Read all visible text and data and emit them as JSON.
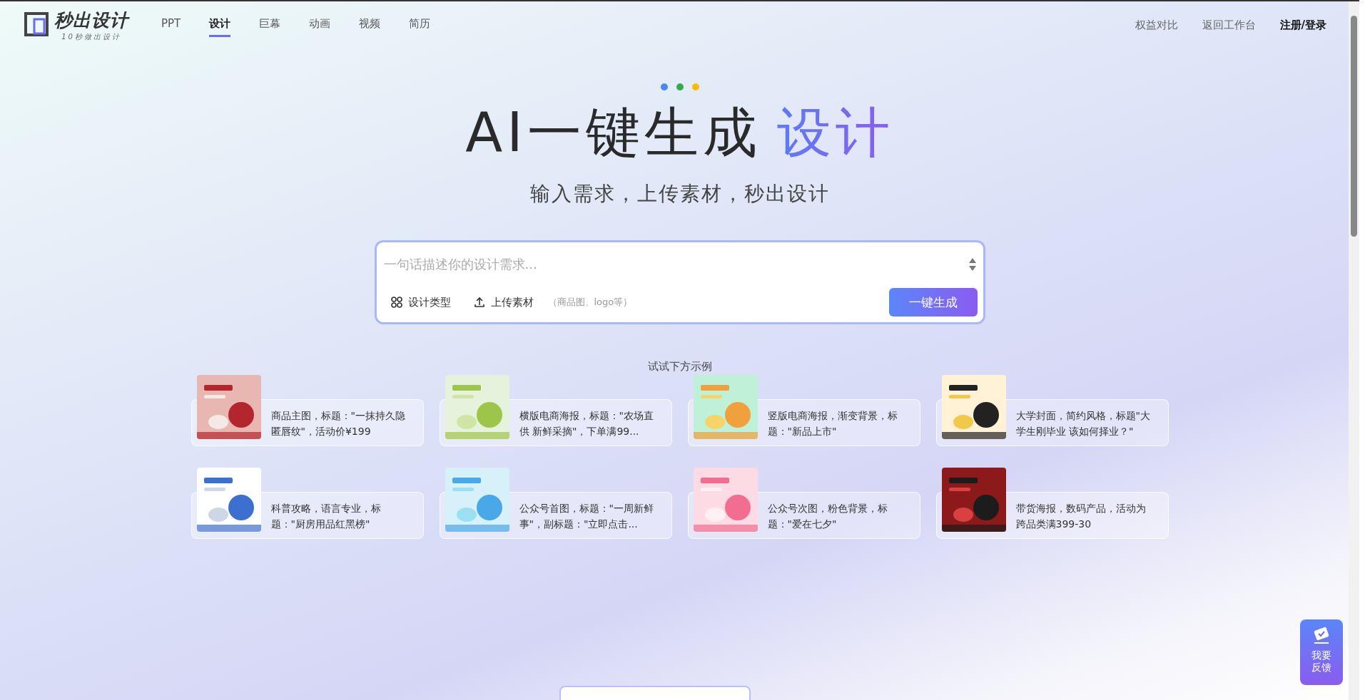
{
  "logo": {
    "name": "秒出设计",
    "tagline": "10秒做出设计"
  },
  "nav": [
    {
      "label": "PPT",
      "selected": false
    },
    {
      "label": "设计",
      "selected": true
    },
    {
      "label": "巨幕",
      "selected": false
    },
    {
      "label": "动画",
      "selected": false
    },
    {
      "label": "视频",
      "selected": false
    },
    {
      "label": "简历",
      "selected": false
    }
  ],
  "top_links": [
    {
      "label": "权益对比",
      "kind": "link"
    },
    {
      "label": "返回工作台",
      "kind": "link"
    },
    {
      "label": "注册/登录",
      "kind": "strong"
    }
  ],
  "hero": {
    "title": "AI一键生成",
    "title_accent": "设计",
    "subtitle": "输入需求，上传素材，秒出设计"
  },
  "prompt": {
    "placeholder": "一句话描述你的设计需求...",
    "type_button": "设计类型",
    "upload_button": "上传素材",
    "upload_hint": "（商品图、logo等）",
    "generate_button": "一键生成"
  },
  "examples_title": "试试下方示例",
  "examples": [
    {
      "text": "商品主图，标题：\"一抹持久隐匿唇纹\"，活动价¥199",
      "kind": "picture"
    },
    {
      "text": "横版电商海报，标题：\"农场直供 新鲜采摘\"，下单满99...",
      "kind": "picture"
    },
    {
      "text": "竖版电商海报，渐变背景，标题：\"新品上市\"",
      "kind": "picture"
    },
    {
      "text": "大学封面，简约风格，标题\"大学生刚毕业 该如何择业？\"",
      "kind": "picture"
    },
    {
      "text": "科普攻略，语言专业，标题：\"厨房用品红黑榜\"",
      "kind": "picture"
    },
    {
      "text": "公众号首图，标题：\"一周新鲜事\"，副标题：\"立即点击...",
      "kind": "picture"
    },
    {
      "text": "公众号次图，粉色背景，标题：\"爱在七夕\"",
      "kind": "picture"
    },
    {
      "text": "带货海报，数码产品，活动为跨品类满399-30",
      "kind": "picture"
    }
  ],
  "feedback": {
    "label": "我要反馈"
  }
}
